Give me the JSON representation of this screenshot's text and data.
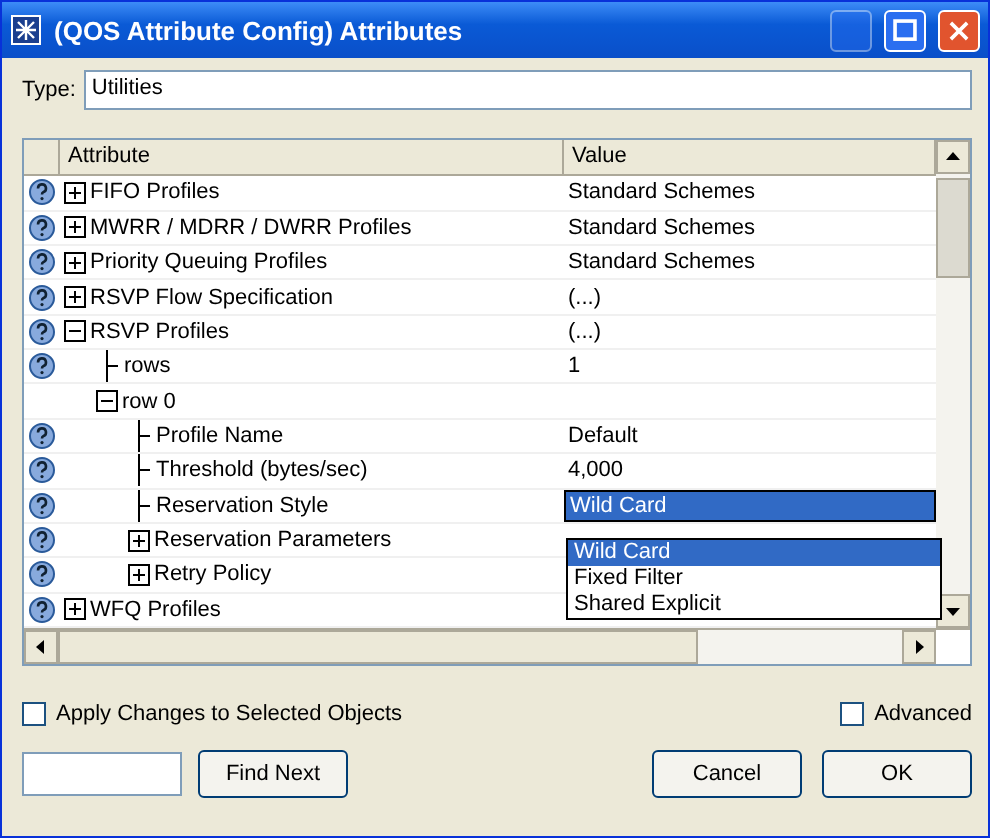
{
  "window": {
    "title": "(QOS Attribute Config) Attributes"
  },
  "type_field": {
    "label": "Type:",
    "value": "Utilities"
  },
  "table": {
    "columns": [
      "Attribute",
      "Value"
    ],
    "rows": [
      {
        "label": "FIFO Profiles",
        "value": "Standard Schemes",
        "help": true,
        "expanded": false
      },
      {
        "label": "MWRR / MDRR / DWRR Profiles",
        "value": "Standard Schemes",
        "help": true,
        "expanded": false
      },
      {
        "label": "Priority Queuing Profiles",
        "value": "Standard Schemes",
        "help": true,
        "expanded": false
      },
      {
        "label": "RSVP Flow Specification",
        "value": "(...)",
        "help": true,
        "expanded": false
      },
      {
        "label": "RSVP Profiles",
        "value": "(...)",
        "help": true,
        "expanded": true,
        "children": [
          {
            "label": "rows",
            "value": "1",
            "help": true
          },
          {
            "label": "row 0",
            "help": false,
            "expanded": true,
            "children": [
              {
                "label": "Profile Name",
                "value": "Default",
                "help": true
              },
              {
                "label": "Threshold (bytes/sec)",
                "value": "4,000",
                "help": true
              },
              {
                "label": "Reservation Style",
                "value": "Wild Card",
                "help": true,
                "selected": true
              },
              {
                "label": "Reservation Parameters",
                "help": true,
                "expanded": false
              },
              {
                "label": "Retry Policy",
                "help": true,
                "expanded": false
              }
            ]
          }
        ]
      },
      {
        "label": "WFQ Profiles",
        "help": true,
        "expanded": false
      }
    ]
  },
  "dropdown": {
    "options": [
      {
        "label": "Wild Card",
        "selected": true
      },
      {
        "label": "Fixed Filter",
        "selected": false
      },
      {
        "label": "Shared Explicit",
        "selected": false
      }
    ]
  },
  "apply_checkbox": {
    "label": "Apply Changes to Selected Objects",
    "checked": false
  },
  "advanced_checkbox": {
    "label": "Advanced",
    "checked": false
  },
  "buttons": [
    {
      "kind": "search",
      "label": "Find Next"
    },
    {
      "kind": "cancel",
      "label": "Cancel"
    },
    {
      "kind": "ok",
      "label": "OK"
    }
  ]
}
